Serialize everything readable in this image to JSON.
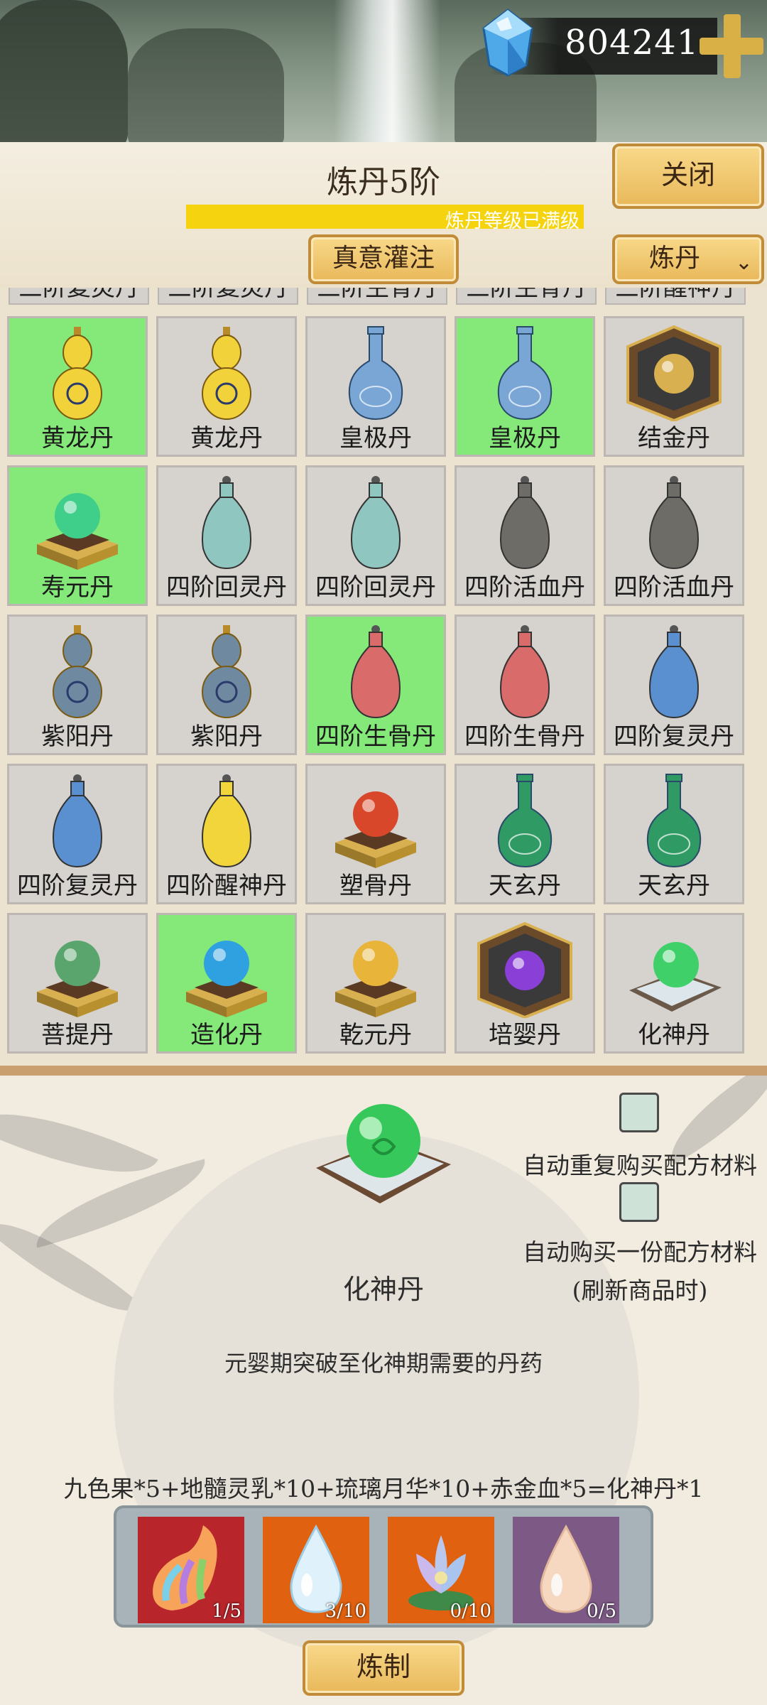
{
  "currency": {
    "icon": "diamond-gem-icon",
    "value": "804241",
    "plus_icon": "plus-icon"
  },
  "header": {
    "title": "炼丹5阶",
    "progress": {
      "fraction": 1.0,
      "text": "炼丹等级已满级"
    },
    "close_label": "关闭",
    "infuse_label": "真意灌注",
    "mode_label": "炼丹",
    "mode_icon": "chevron-down-icon"
  },
  "grid": {
    "partial_row": [
      "三阶复灵丹",
      "三阶复灵丹",
      "三阶生骨丹",
      "三阶生骨丹",
      "三阶醒神丹"
    ],
    "items": [
      {
        "label": "黄龙丹",
        "icon": "gourd-icon",
        "color": "#f1d23a",
        "selected": true
      },
      {
        "label": "黄龙丹",
        "icon": "gourd-icon",
        "color": "#f1d23a",
        "selected": false
      },
      {
        "label": "皇极丹",
        "icon": "vase-icon",
        "color": "#7aa6d6",
        "selected": false
      },
      {
        "label": "皇极丹",
        "icon": "vase-icon",
        "color": "#7aa6d6",
        "selected": true
      },
      {
        "label": "结金丹",
        "icon": "box-orb-icon",
        "color": "#d9b050",
        "selected": false
      },
      {
        "label": "寿元丹",
        "icon": "orb-stand-icon",
        "color": "#3fcf8a",
        "selected": true
      },
      {
        "label": "四阶回灵丹",
        "icon": "bottle-icon",
        "color": "#8fc6c0",
        "selected": false
      },
      {
        "label": "四阶回灵丹",
        "icon": "bottle-icon",
        "color": "#8fc6c0",
        "selected": false
      },
      {
        "label": "四阶活血丹",
        "icon": "bottle-icon",
        "color": "#6e6c66",
        "selected": false
      },
      {
        "label": "四阶活血丹",
        "icon": "bottle-icon",
        "color": "#6e6c66",
        "selected": false
      },
      {
        "label": "紫阳丹",
        "icon": "gourd-icon",
        "color": "#6f8aa0",
        "selected": false
      },
      {
        "label": "紫阳丹",
        "icon": "gourd-icon",
        "color": "#6f8aa0",
        "selected": false
      },
      {
        "label": "四阶生骨丹",
        "icon": "bottle-icon",
        "color": "#d96b6b",
        "selected": true
      },
      {
        "label": "四阶生骨丹",
        "icon": "bottle-icon",
        "color": "#d96b6b",
        "selected": false
      },
      {
        "label": "四阶复灵丹",
        "icon": "bottle-icon",
        "color": "#5a90d0",
        "selected": false
      },
      {
        "label": "四阶复灵丹",
        "icon": "bottle-icon",
        "color": "#5a90d0",
        "selected": false
      },
      {
        "label": "四阶醒神丹",
        "icon": "bottle-icon",
        "color": "#f2d53b",
        "selected": false
      },
      {
        "label": "塑骨丹",
        "icon": "orb-stand-icon",
        "color": "#d9472b",
        "selected": false
      },
      {
        "label": "天玄丹",
        "icon": "vase-icon",
        "color": "#2f9a63",
        "selected": false
      },
      {
        "label": "天玄丹",
        "icon": "vase-icon",
        "color": "#2f9a63",
        "selected": false
      },
      {
        "label": "菩提丹",
        "icon": "orb-stand-icon",
        "color": "#5aa56e",
        "selected": false
      },
      {
        "label": "造化丹",
        "icon": "orb-stand-icon",
        "color": "#2fa0e0",
        "selected": true
      },
      {
        "label": "乾元丹",
        "icon": "orb-stand-icon",
        "color": "#e8b53a",
        "selected": false
      },
      {
        "label": "培婴丹",
        "icon": "box-orb-icon",
        "color": "#8a3fd6",
        "selected": false
      },
      {
        "label": "化神丹",
        "icon": "orb-cushion-icon",
        "color": "#3fd06a",
        "selected": false
      }
    ]
  },
  "detail": {
    "name": "化神丹",
    "icon": "orb-cushion-icon",
    "description": "元婴期突破至化神期需要的丹药",
    "option1_label": "自动重复购买配方材料",
    "option2_line1": "自动购买一份配方材料",
    "option2_line2": "(刷新商品时)",
    "recipe": "九色果*5+地髓灵乳*10+琉璃月华*10+赤金血*5=化神丹*1",
    "materials": [
      {
        "name": "九色果",
        "icon": "rainbow-fruit-icon",
        "bg": "#b8262b",
        "count": "1/5"
      },
      {
        "name": "地髓灵乳",
        "icon": "water-drop-icon",
        "bg": "#e0610f",
        "count": "3/10"
      },
      {
        "name": "琉璃月华",
        "icon": "lotus-icon",
        "bg": "#e0610f",
        "count": "0/10"
      },
      {
        "name": "赤金血",
        "icon": "peach-drop-icon",
        "bg": "#7c5a85",
        "count": "0/5"
      }
    ],
    "craft_label": "炼制"
  }
}
